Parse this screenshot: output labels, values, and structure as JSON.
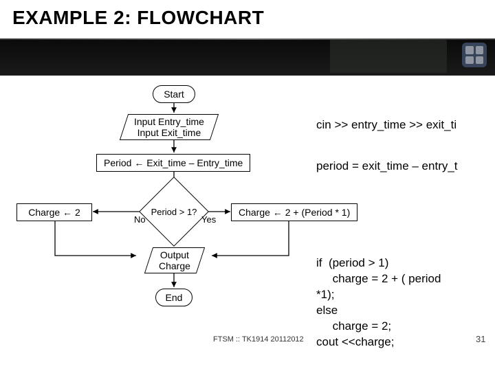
{
  "title": "EXAMPLE 2: FLOWCHART",
  "footer": "FTSM :: TK1914 20112012",
  "page_number": "31",
  "flow": {
    "start": "Start",
    "input_line1": "Input Entry_time",
    "input_line2": "Input Exit_time",
    "period_assign": "Period ← Exit_time – Entry_time",
    "charge2": "Charge ← 2",
    "decision": "Period > 1?",
    "no": "No",
    "yes": "Yes",
    "charge_calc": "Charge ← 2 + (Period * 1)",
    "output": "Output\nCharge",
    "end": "End"
  },
  "code": {
    "cin": "cin >> entry_time >> exit_ti",
    "period": "period = exit_time – entry_t",
    "block": "if  (period > 1)\n     charge = 2 + ( period\n*1);\nelse\n     charge = 2;\ncout <<charge;"
  },
  "chart_data": {
    "type": "flowchart",
    "nodes": [
      {
        "id": "start",
        "shape": "terminator",
        "text": "Start"
      },
      {
        "id": "input",
        "shape": "io",
        "text": "Input Entry_time\\nInput Exit_time"
      },
      {
        "id": "period",
        "shape": "process",
        "text": "Period ← Exit_time – Entry_time"
      },
      {
        "id": "decision",
        "shape": "decision",
        "text": "Period > 1?"
      },
      {
        "id": "charge2",
        "shape": "process",
        "text": "Charge ← 2"
      },
      {
        "id": "chargecalc",
        "shape": "process",
        "text": "Charge ← 2 + (Period * 1)"
      },
      {
        "id": "output",
        "shape": "io",
        "text": "Output Charge"
      },
      {
        "id": "end",
        "shape": "terminator",
        "text": "End"
      }
    ],
    "edges": [
      {
        "from": "start",
        "to": "input"
      },
      {
        "from": "input",
        "to": "period"
      },
      {
        "from": "period",
        "to": "decision"
      },
      {
        "from": "decision",
        "to": "charge2",
        "label": "No"
      },
      {
        "from": "decision",
        "to": "chargecalc",
        "label": "Yes"
      },
      {
        "from": "charge2",
        "to": "output"
      },
      {
        "from": "chargecalc",
        "to": "output"
      },
      {
        "from": "output",
        "to": "end"
      }
    ],
    "annotations": [
      {
        "at": "input",
        "code": "cin >> entry_time >> exit_time;"
      },
      {
        "at": "period",
        "code": "period = exit_time – entry_time;"
      },
      {
        "at": "decision/output",
        "code": "if (period > 1) charge = 2 + ( period *1); else charge = 2; cout <<charge;"
      }
    ]
  }
}
